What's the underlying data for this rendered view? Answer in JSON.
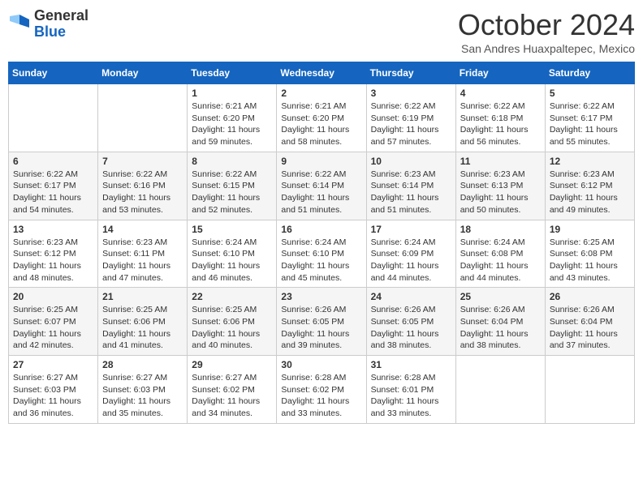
{
  "header": {
    "logo_general": "General",
    "logo_blue": "Blue",
    "month_title": "October 2024",
    "subtitle": "San Andres Huaxpaltepec, Mexico"
  },
  "days_of_week": [
    "Sunday",
    "Monday",
    "Tuesday",
    "Wednesday",
    "Thursday",
    "Friday",
    "Saturday"
  ],
  "weeks": [
    [
      {
        "day": "",
        "detail": ""
      },
      {
        "day": "",
        "detail": ""
      },
      {
        "day": "1",
        "detail": "Sunrise: 6:21 AM\nSunset: 6:20 PM\nDaylight: 11 hours and 59 minutes."
      },
      {
        "day": "2",
        "detail": "Sunrise: 6:21 AM\nSunset: 6:20 PM\nDaylight: 11 hours and 58 minutes."
      },
      {
        "day": "3",
        "detail": "Sunrise: 6:22 AM\nSunset: 6:19 PM\nDaylight: 11 hours and 57 minutes."
      },
      {
        "day": "4",
        "detail": "Sunrise: 6:22 AM\nSunset: 6:18 PM\nDaylight: 11 hours and 56 minutes."
      },
      {
        "day": "5",
        "detail": "Sunrise: 6:22 AM\nSunset: 6:17 PM\nDaylight: 11 hours and 55 minutes."
      }
    ],
    [
      {
        "day": "6",
        "detail": "Sunrise: 6:22 AM\nSunset: 6:17 PM\nDaylight: 11 hours and 54 minutes."
      },
      {
        "day": "7",
        "detail": "Sunrise: 6:22 AM\nSunset: 6:16 PM\nDaylight: 11 hours and 53 minutes."
      },
      {
        "day": "8",
        "detail": "Sunrise: 6:22 AM\nSunset: 6:15 PM\nDaylight: 11 hours and 52 minutes."
      },
      {
        "day": "9",
        "detail": "Sunrise: 6:22 AM\nSunset: 6:14 PM\nDaylight: 11 hours and 51 minutes."
      },
      {
        "day": "10",
        "detail": "Sunrise: 6:23 AM\nSunset: 6:14 PM\nDaylight: 11 hours and 51 minutes."
      },
      {
        "day": "11",
        "detail": "Sunrise: 6:23 AM\nSunset: 6:13 PM\nDaylight: 11 hours and 50 minutes."
      },
      {
        "day": "12",
        "detail": "Sunrise: 6:23 AM\nSunset: 6:12 PM\nDaylight: 11 hours and 49 minutes."
      }
    ],
    [
      {
        "day": "13",
        "detail": "Sunrise: 6:23 AM\nSunset: 6:12 PM\nDaylight: 11 hours and 48 minutes."
      },
      {
        "day": "14",
        "detail": "Sunrise: 6:23 AM\nSunset: 6:11 PM\nDaylight: 11 hours and 47 minutes."
      },
      {
        "day": "15",
        "detail": "Sunrise: 6:24 AM\nSunset: 6:10 PM\nDaylight: 11 hours and 46 minutes."
      },
      {
        "day": "16",
        "detail": "Sunrise: 6:24 AM\nSunset: 6:10 PM\nDaylight: 11 hours and 45 minutes."
      },
      {
        "day": "17",
        "detail": "Sunrise: 6:24 AM\nSunset: 6:09 PM\nDaylight: 11 hours and 44 minutes."
      },
      {
        "day": "18",
        "detail": "Sunrise: 6:24 AM\nSunset: 6:08 PM\nDaylight: 11 hours and 44 minutes."
      },
      {
        "day": "19",
        "detail": "Sunrise: 6:25 AM\nSunset: 6:08 PM\nDaylight: 11 hours and 43 minutes."
      }
    ],
    [
      {
        "day": "20",
        "detail": "Sunrise: 6:25 AM\nSunset: 6:07 PM\nDaylight: 11 hours and 42 minutes."
      },
      {
        "day": "21",
        "detail": "Sunrise: 6:25 AM\nSunset: 6:06 PM\nDaylight: 11 hours and 41 minutes."
      },
      {
        "day": "22",
        "detail": "Sunrise: 6:25 AM\nSunset: 6:06 PM\nDaylight: 11 hours and 40 minutes."
      },
      {
        "day": "23",
        "detail": "Sunrise: 6:26 AM\nSunset: 6:05 PM\nDaylight: 11 hours and 39 minutes."
      },
      {
        "day": "24",
        "detail": "Sunrise: 6:26 AM\nSunset: 6:05 PM\nDaylight: 11 hours and 38 minutes."
      },
      {
        "day": "25",
        "detail": "Sunrise: 6:26 AM\nSunset: 6:04 PM\nDaylight: 11 hours and 38 minutes."
      },
      {
        "day": "26",
        "detail": "Sunrise: 6:26 AM\nSunset: 6:04 PM\nDaylight: 11 hours and 37 minutes."
      }
    ],
    [
      {
        "day": "27",
        "detail": "Sunrise: 6:27 AM\nSunset: 6:03 PM\nDaylight: 11 hours and 36 minutes."
      },
      {
        "day": "28",
        "detail": "Sunrise: 6:27 AM\nSunset: 6:03 PM\nDaylight: 11 hours and 35 minutes."
      },
      {
        "day": "29",
        "detail": "Sunrise: 6:27 AM\nSunset: 6:02 PM\nDaylight: 11 hours and 34 minutes."
      },
      {
        "day": "30",
        "detail": "Sunrise: 6:28 AM\nSunset: 6:02 PM\nDaylight: 11 hours and 33 minutes."
      },
      {
        "day": "31",
        "detail": "Sunrise: 6:28 AM\nSunset: 6:01 PM\nDaylight: 11 hours and 33 minutes."
      },
      {
        "day": "",
        "detail": ""
      },
      {
        "day": "",
        "detail": ""
      }
    ]
  ]
}
